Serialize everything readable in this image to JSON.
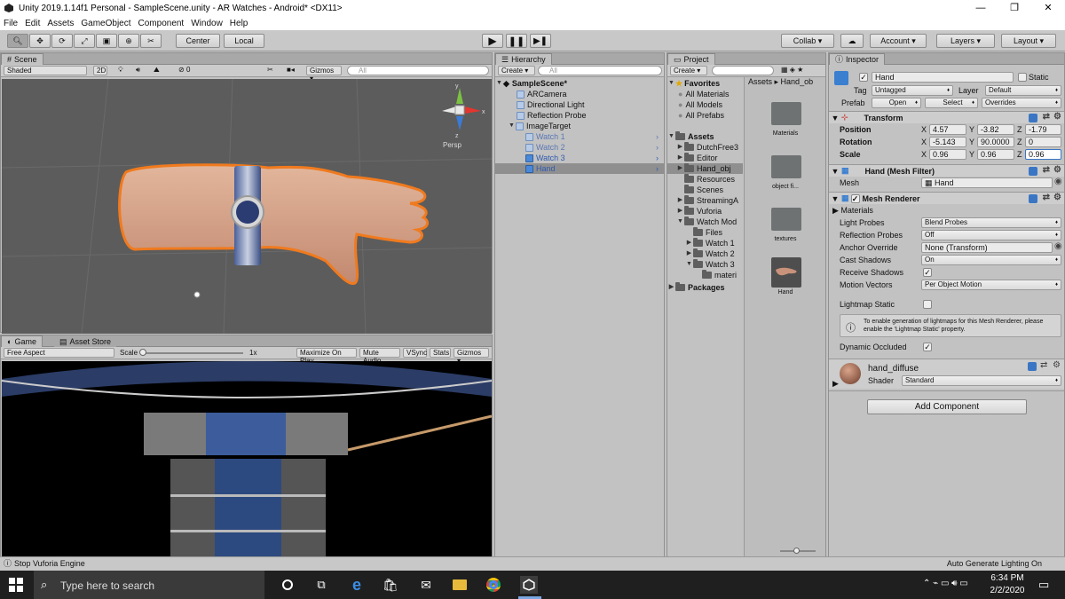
{
  "window": {
    "title": "Unity 2019.1.14f1 Personal - SampleScene.unity - AR Watches - Android* <DX11>"
  },
  "menu": [
    "File",
    "Edit",
    "Assets",
    "GameObject",
    "Component",
    "Window",
    "Help"
  ],
  "toolbar": {
    "center": "Center",
    "local": "Local",
    "collab": "Collab ▾",
    "account": "Account",
    "layers": "Layers",
    "layout": "Layout"
  },
  "scene": {
    "tab": "Scene",
    "shading": "Shaded",
    "mode2d": "2D",
    "fx_count": "0",
    "gizmos": "Gizmos",
    "search_placeholder": "All",
    "persp": "Persp"
  },
  "game": {
    "tab": "Game",
    "asset_store_tab": "Asset Store",
    "aspect": "Free Aspect",
    "scale_label": "Scale",
    "scale_value": "1x",
    "buttons": [
      "Maximize On Play",
      "Mute Audio",
      "VSync",
      "Stats",
      "Gizmos"
    ]
  },
  "hierarchy": {
    "tab": "Hierarchy",
    "create": "Create",
    "search_placeholder": "All",
    "scene": "SampleScene*",
    "items": [
      "ARCamera",
      "Directional Light",
      "Reflection Probe",
      "ImageTarget",
      "Watch 1",
      "Watch 2",
      "Watch 3",
      "Hand"
    ]
  },
  "project": {
    "tab": "Project",
    "create": "Create",
    "favorites": "Favorites",
    "fav_items": [
      "All Materials",
      "All Models",
      "All Prefabs"
    ],
    "assets": "Assets",
    "asset_folders": [
      "DutchFree3",
      "Editor",
      "Hand_obj",
      "Resources",
      "Scenes",
      "StreamingA",
      "Vuforia",
      "Watch Mod"
    ],
    "watch_sub": [
      "Files",
      "Watch 1",
      "Watch 2",
      "Watch 3"
    ],
    "materi": "materi",
    "packages": "Packages",
    "breadcrumb": [
      "Assets",
      "Hand_ob"
    ],
    "grid_items": [
      "Materials",
      "object fi...",
      "textures",
      "Hand"
    ]
  },
  "inspector": {
    "tab": "Inspector",
    "name": "Hand",
    "static": "Static",
    "tag_label": "Tag",
    "tag": "Untagged",
    "layer_label": "Layer",
    "layer": "Default",
    "prefab_label": "Prefab",
    "open": "Open",
    "select": "Select",
    "overrides": "Overrides",
    "transform": {
      "title": "Transform",
      "position": {
        "label": "Position",
        "x": "4.57",
        "y": "-3.82",
        "z": "-1.79"
      },
      "rotation": {
        "label": "Rotation",
        "x": "-5.143",
        "y": "90.0000",
        "z": "0"
      },
      "scale": {
        "label": "Scale",
        "x": "0.96",
        "y": "0.96",
        "z": "0.96"
      }
    },
    "mesh_filter": {
      "title": "Hand (Mesh Filter)",
      "mesh_label": "Mesh",
      "mesh": "Hand"
    },
    "mesh_renderer": {
      "title": "Mesh Renderer",
      "materials": "Materials",
      "light_probes_label": "Light Probes",
      "light_probes": "Blend Probes",
      "reflection_label": "Reflection Probes",
      "reflection": "Off",
      "anchor_label": "Anchor Override",
      "anchor": "None (Transform)",
      "cast_label": "Cast Shadows",
      "cast": "On",
      "receive_label": "Receive Shadows",
      "motion_label": "Motion Vectors",
      "motion": "Per Object Motion",
      "lightmap_label": "Lightmap Static",
      "info": "To enable generation of lightmaps for this Mesh Renderer, please enable the 'Lightmap Static' property.",
      "dynamic_label": "Dynamic Occluded"
    },
    "material": {
      "name": "hand_diffuse",
      "shader_label": "Shader",
      "shader": "Standard"
    },
    "add_component": "Add Component"
  },
  "status": {
    "left": "Stop Vuforia Engine",
    "right": "Auto Generate Lighting On"
  },
  "taskbar": {
    "search": "Type here to search",
    "time": "6:34 PM",
    "date": "2/2/2020"
  }
}
